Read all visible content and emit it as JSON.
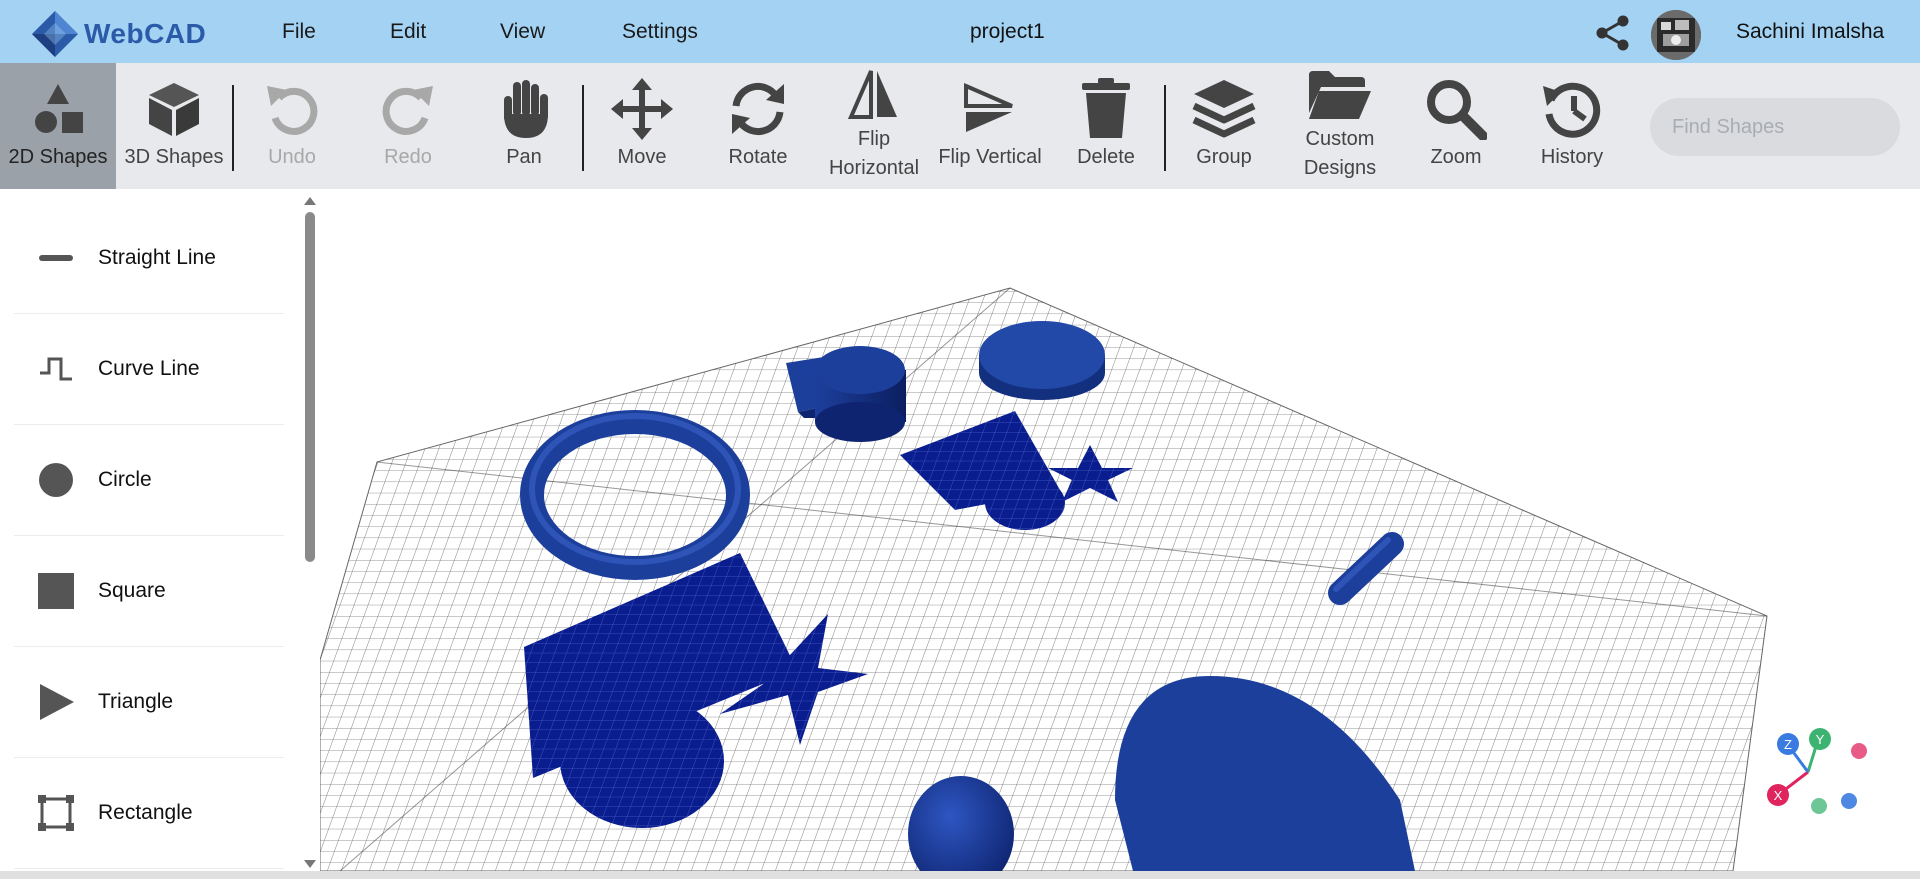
{
  "app": {
    "name": "WebCAD",
    "project_title": "project1",
    "user_name": "Sachini Imalsha"
  },
  "menu": [
    {
      "label": "File"
    },
    {
      "label": "Edit"
    },
    {
      "label": "View"
    },
    {
      "label": "Settings"
    }
  ],
  "toolbar": {
    "tools": [
      {
        "label": "2D Shapes",
        "icon": "shapes-2d-icon",
        "state": "active"
      },
      {
        "label": "3D Shapes",
        "icon": "cube-icon",
        "state": "normal"
      },
      {
        "label": "Undo",
        "icon": "undo-icon",
        "state": "disabled"
      },
      {
        "label": "Redo",
        "icon": "redo-icon",
        "state": "disabled"
      },
      {
        "label": "Pan",
        "icon": "hand-icon",
        "state": "normal"
      },
      {
        "label": "Move",
        "icon": "move-arrows-icon",
        "state": "normal"
      },
      {
        "label": "Rotate",
        "icon": "rotate-icon",
        "state": "normal"
      },
      {
        "label": "Flip\nHorizontal",
        "icon": "flip-horizontal-icon",
        "state": "normal"
      },
      {
        "label": "Flip Vertical",
        "icon": "flip-vertical-icon",
        "state": "normal"
      },
      {
        "label": "Delete",
        "icon": "trash-icon",
        "state": "normal"
      },
      {
        "label": "Group",
        "icon": "layers-icon",
        "state": "normal"
      },
      {
        "label": "Custom\nDesigns",
        "icon": "folder-open-icon",
        "state": "normal"
      },
      {
        "label": "Zoom",
        "icon": "magnifier-icon",
        "state": "normal"
      },
      {
        "label": "History",
        "icon": "history-icon",
        "state": "normal"
      }
    ],
    "search_placeholder": "Find Shapes"
  },
  "sidebar": {
    "items": [
      {
        "label": "Straight Line",
        "icon": "straight-line-icon"
      },
      {
        "label": "Curve Line",
        "icon": "curve-line-icon"
      },
      {
        "label": "Circle",
        "icon": "circle-icon"
      },
      {
        "label": "Square",
        "icon": "square-icon"
      },
      {
        "label": "Triangle",
        "icon": "triangle-icon"
      },
      {
        "label": "Rectangle",
        "icon": "rectangle-icon"
      }
    ]
  },
  "viewport": {
    "axes": [
      "X",
      "Y",
      "Z"
    ],
    "shape_color": "#1d3f9c",
    "flat_shape_color": "#0a1d8e"
  },
  "colors": {
    "menubar": "#a3d2f3",
    "toolbar": "#e8e9ec",
    "accent": "#2a5aa8",
    "axis_x": "#e0245e",
    "axis_y": "#3cb371",
    "axis_z": "#3a7be0"
  }
}
